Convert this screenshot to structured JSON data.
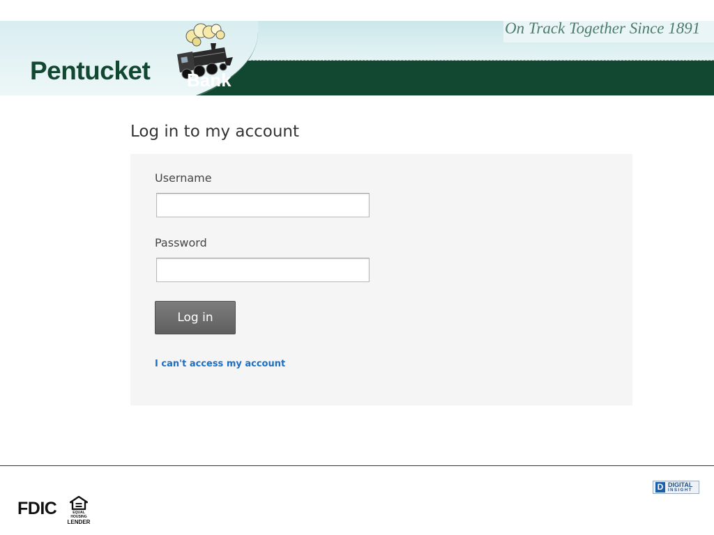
{
  "header": {
    "brand_name": "Pentucket",
    "brand_suffix": "Bank",
    "tagline": "On Track Together Since 1891",
    "logo_icon": "steam-train-icon",
    "colors": {
      "brand_green": "#124832",
      "sky": "#cbe7ea"
    }
  },
  "login": {
    "title": "Log in to my account",
    "username_label": "Username",
    "username_value": "",
    "password_label": "Password",
    "password_value": "",
    "submit_label": "Log in",
    "help_link": "I can't access my account",
    "colors": {
      "button": "#6b6b6b",
      "link": "#1a6fc4",
      "panel": "#f5f5f5"
    }
  },
  "footer": {
    "fdic_label": "FDIC",
    "equal_housing_line1": "EQUAL HOUSING",
    "equal_housing_line2": "LENDER",
    "provider_line1": "DIGITAL",
    "provider_line2": "INSIGHT",
    "provider_icon_letter": "D"
  }
}
